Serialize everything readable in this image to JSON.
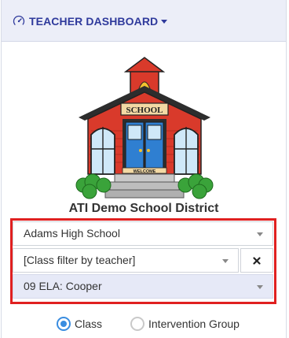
{
  "header": {
    "title": "TEACHER DASHBOARD",
    "icon": "gauge-icon"
  },
  "logo": {
    "sign_text": "SCHOOL",
    "mat_text": "WELCOME"
  },
  "district": {
    "name": "ATI Demo School District"
  },
  "filters": {
    "school": {
      "value": "Adams High School"
    },
    "teacher_filter": {
      "value": "[Class filter by teacher]",
      "clear_icon": "close-icon"
    },
    "class": {
      "value": "09 ELA: Cooper"
    }
  },
  "group_type": {
    "options": [
      {
        "label": "Class",
        "selected": true
      },
      {
        "label": "Intervention Group",
        "selected": false
      }
    ]
  },
  "colors": {
    "header_bg": "#eceef8",
    "accent": "#2f3a9c",
    "highlight_border": "#e02020",
    "radio_active": "#3a8de0"
  }
}
